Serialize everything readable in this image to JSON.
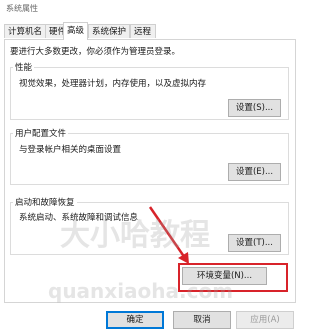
{
  "window": {
    "title": "系统属性"
  },
  "tabs": [
    {
      "label": "计算机名"
    },
    {
      "label": "硬件"
    },
    {
      "label": "高级"
    },
    {
      "label": "系统保护"
    },
    {
      "label": "远程"
    }
  ],
  "notice": "要进行大多数更改，你必须作为管理员登录。",
  "performance": {
    "title": "性能",
    "description": "视觉效果，处理器计划，内存使用，以及虚拟内存",
    "button": "设置(S)..."
  },
  "user_profiles": {
    "title": "用户配置文件",
    "description": "与登录帐户相关的桌面设置",
    "button": "设置(E)..."
  },
  "startup_recovery": {
    "title": "启动和故障恢复",
    "description": "系统启动、系统故障和调试信息",
    "button": "设置(T)..."
  },
  "env_button": "环境变量(N)...",
  "footer": {
    "ok": "确定",
    "cancel": "取消",
    "apply": "应用(A)"
  },
  "watermark": {
    "cn": "大小哈教程",
    "en": "quanxiaoha.com"
  },
  "colors": {
    "highlight": "#d8232a",
    "accent": "#0078d7"
  }
}
